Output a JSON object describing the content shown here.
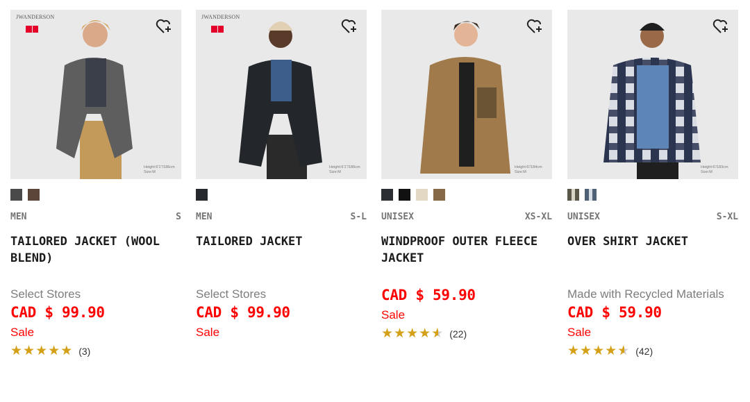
{
  "products": [
    {
      "brand": "JWANDERSON",
      "height_note": "Height:6'1\"/186cm Size:M",
      "swatches": [
        "#4a4a4a",
        "#5c4639"
      ],
      "gender": "MEN",
      "size": "S",
      "name": "TAILORED JACKET (WOOL BLEND)",
      "note": "Select Stores",
      "price": "CAD $ 99.90",
      "sale": "Sale",
      "rating_value": 5,
      "rating_count": "(3)"
    },
    {
      "brand": "JWANDERSON",
      "height_note": "Height:6'1\"/186cm Size:M",
      "swatches": [
        "#26292d"
      ],
      "gender": "MEN",
      "size": "S-L",
      "name": "TAILORED JACKET",
      "note": "Select Stores",
      "price": "CAD $ 99.90",
      "sale": "Sale"
    },
    {
      "height_note": "Height:6'/184cm Size:M",
      "swatches": [
        "#2b2f34",
        "#111111",
        "#e2d8c4",
        "#866a45"
      ],
      "gender": "UNISEX",
      "size": "XS-XL",
      "name": "WINDPROOF OUTER FLEECE JACKET",
      "price": "CAD $ 59.90",
      "sale": "Sale",
      "rating_value": 4.5,
      "rating_count": "(22)"
    },
    {
      "height_note": "Height:6'/183cm Size:M",
      "swatches": [
        "#8a8577",
        "#6c7f90"
      ],
      "gender": "UNISEX",
      "size": "S-XL",
      "name": "OVER SHIRT JACKET",
      "note": "Made with Recycled Materials",
      "price": "CAD $ 59.90",
      "sale": "Sale",
      "rating_value": 4.5,
      "rating_count": "(42)"
    }
  ],
  "colors": {
    "price": "#ff0000",
    "star": "#d4a017",
    "image_bg": "#e8e8e8"
  },
  "icons": {
    "favorite": "heart-plus-icon",
    "star": "star-icon"
  }
}
